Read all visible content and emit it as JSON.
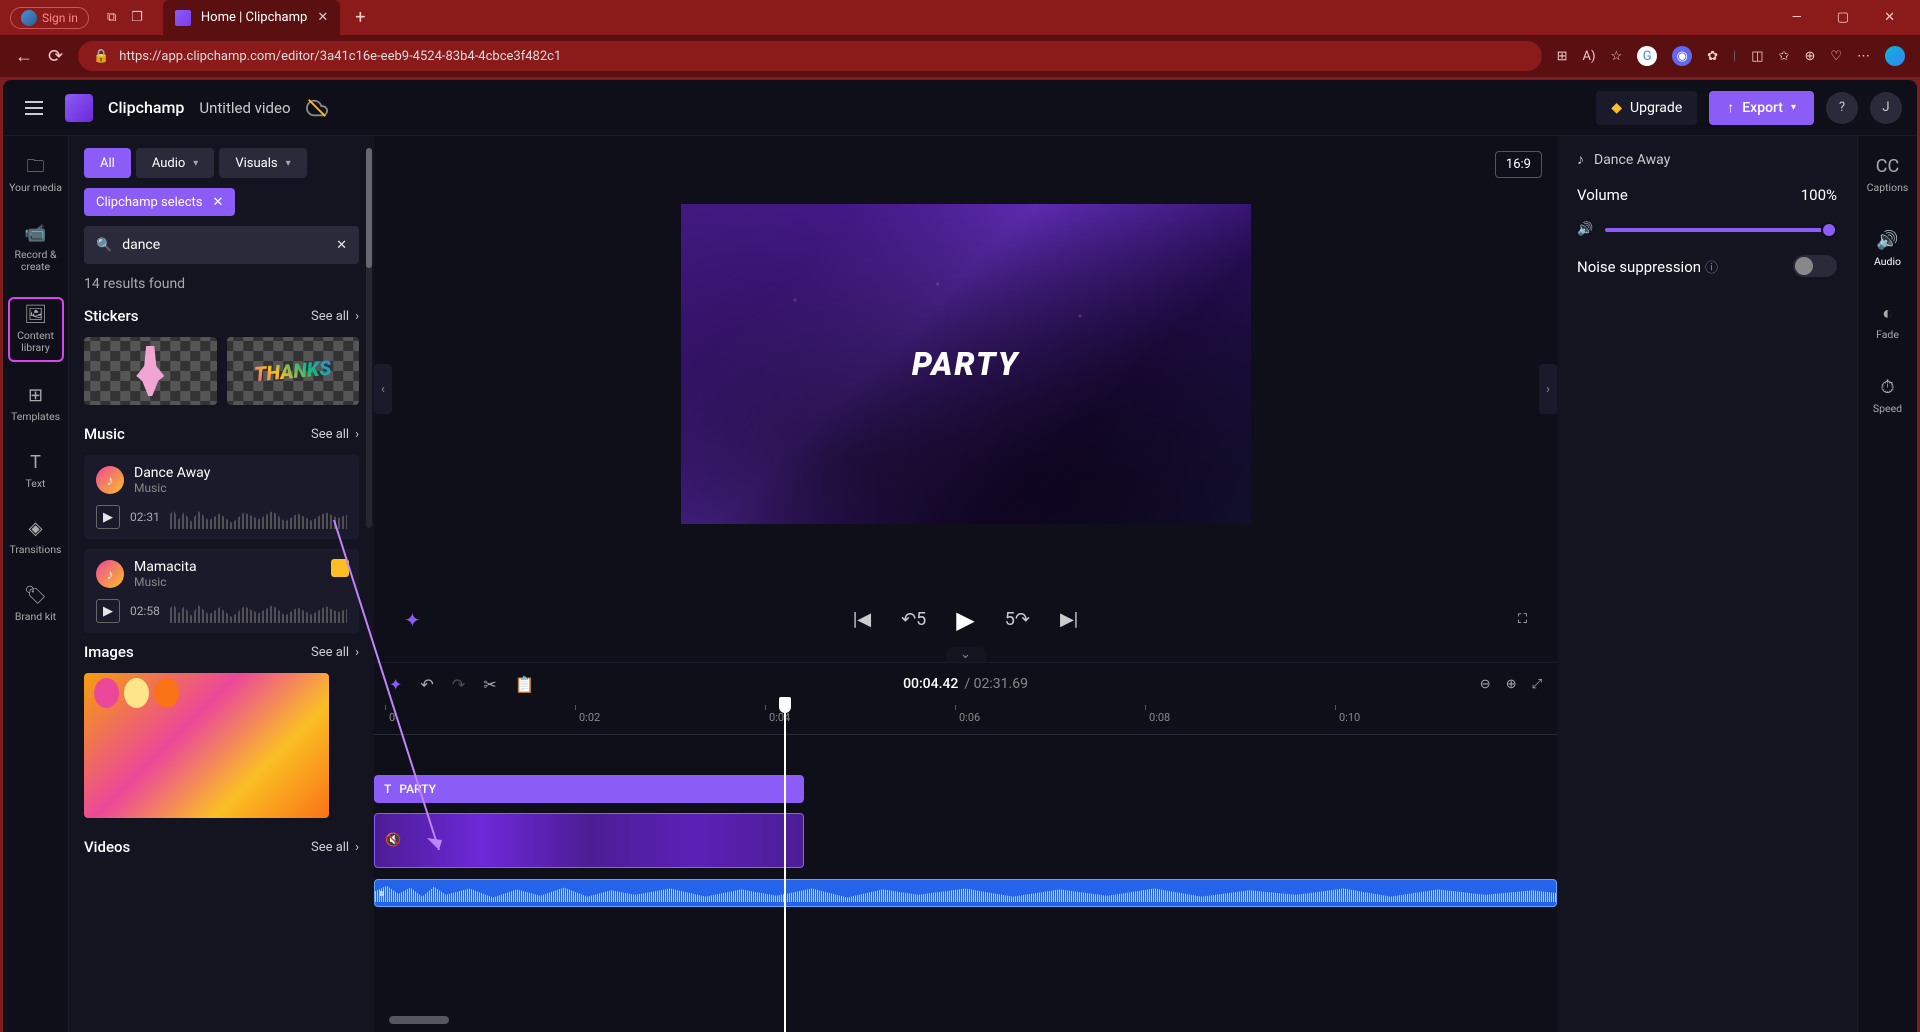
{
  "browser": {
    "sign_in": "Sign in",
    "tab_title": "Home | Clipchamp",
    "url": "https://app.clipchamp.com/editor/3a41c16e-eeb9-4524-83b4-4cbce3f482c1"
  },
  "header": {
    "app_name": "Clipchamp",
    "project_name": "Untitled video",
    "upgrade": "Upgrade",
    "export": "Export",
    "user_initial": "J"
  },
  "left_rail": {
    "your_media": "Your media",
    "record": "Record & create",
    "content_library": "Content library",
    "templates": "Templates",
    "text": "Text",
    "transitions": "Transitions",
    "brand_kit": "Brand kit"
  },
  "library": {
    "filters": {
      "all": "All",
      "audio": "Audio",
      "visuals": "Visuals"
    },
    "tag": "Clipchamp selects",
    "search_value": "dance",
    "results_count": "14 results found",
    "see_all": "See all",
    "sections": {
      "stickers": "Stickers",
      "music": "Music",
      "images": "Images",
      "videos": "Videos"
    },
    "music_items": [
      {
        "title": "Dance Away",
        "subtitle": "Music",
        "duration": "02:31"
      },
      {
        "title": "Mamacita",
        "subtitle": "Music",
        "duration": "02:58"
      }
    ]
  },
  "preview": {
    "aspect_ratio": "16:9",
    "overlay_text": "PARTY"
  },
  "timeline": {
    "current_time": "00:04.42",
    "total_time": "02:31.69",
    "ticks": [
      "0",
      "0:02",
      "0:04",
      "0:06",
      "0:08",
      "0:10"
    ],
    "text_clip_label": "PARTY"
  },
  "right_panel": {
    "clip_name": "Dance Away",
    "volume_label": "Volume",
    "volume_value": "100%",
    "noise_label": "Noise suppression"
  },
  "right_rail": {
    "captions": "Captions",
    "audio": "Audio",
    "fade": "Fade",
    "speed": "Speed"
  }
}
